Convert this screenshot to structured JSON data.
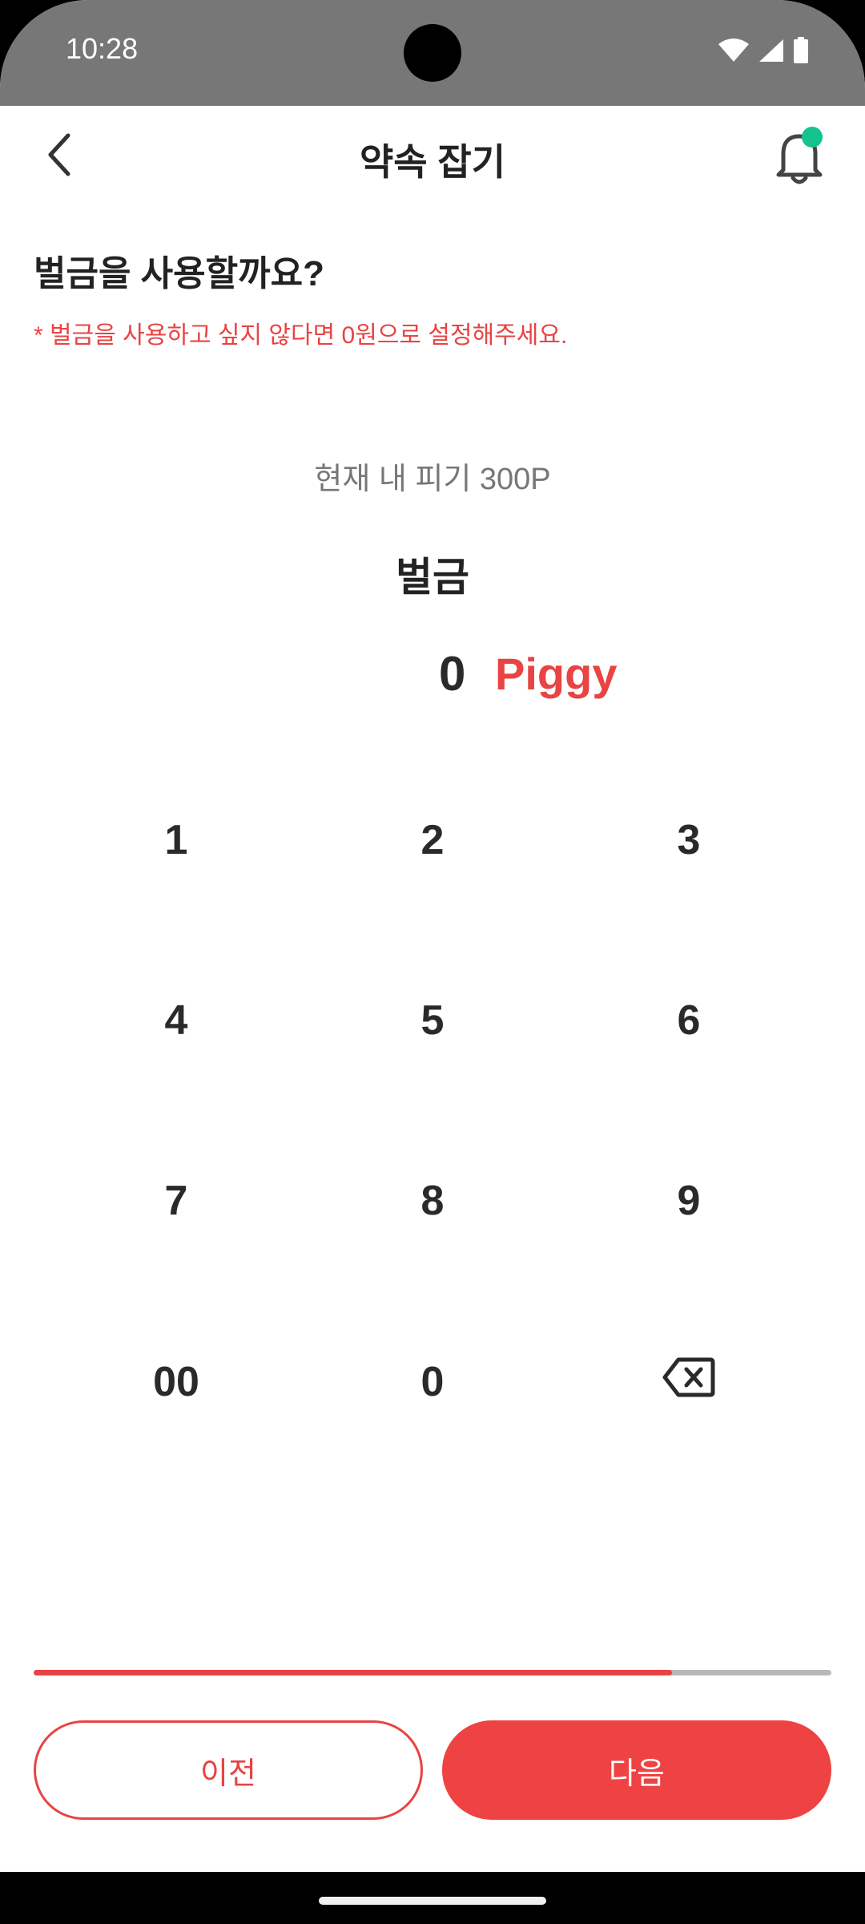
{
  "status_bar": {
    "time": "10:28",
    "icons": [
      "wifi-icon",
      "cellular-signal-icon",
      "battery-icon"
    ]
  },
  "header": {
    "title": "약속 잡기",
    "back_icon": "chevron-left-icon",
    "notification_icon": "bell-icon",
    "notification_dot_color": "#14c38e"
  },
  "content": {
    "question": "벌금을 사용할까요?",
    "notice": "* 벌금을 사용하고 싶지 않다면 0원으로 설정해주세요.",
    "balance": "현재 내 피기 300P",
    "amount_label": "벌금",
    "amount_value": "0",
    "amount_unit": "Piggy"
  },
  "keypad": {
    "keys": [
      "1",
      "2",
      "3",
      "4",
      "5",
      "6",
      "7",
      "8",
      "9",
      "00",
      "0"
    ],
    "backspace_icon": "backspace-icon"
  },
  "progress": {
    "fraction": 0.8
  },
  "buttons": {
    "prev_label": "이전",
    "next_label": "다음"
  },
  "colors": {
    "accent": "#e94343",
    "status_bar": "#777777",
    "text_primary": "#222222"
  }
}
